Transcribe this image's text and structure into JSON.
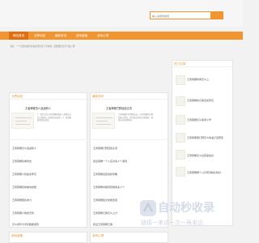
{
  "search": {
    "placeholder": "输入关键词搜索"
  },
  "nav": {
    "items": [
      {
        "label": "网站首页"
      },
      {
        "label": "业界动态"
      },
      {
        "label": "最新资讯"
      },
      {
        "label": "游戏装备"
      },
      {
        "label": "游戏心得"
      }
    ]
  },
  "breadcrumb": "当前：一个出色的项目文档必须包含下列内容，需要我们去学习和了解",
  "hot": {
    "title": "热门文章",
    "items": [
      "王者荣耀刺客怎么上",
      "王者荣耀的元歌该如何玩",
      "王者荣耀怎么使用小号",
      "王者荣耀里打野怎么快速打完野区",
      "王者荣耀怎么出装备最好",
      "王者荣耀哪个公孙离刻制比较好"
    ]
  },
  "news": {
    "title": "业界动态",
    "feature": {
      "title": "王者荣耀怎么选战职人",
      "desc": "1、首先打开王者荣耀游戏进入游戏后点开主界面左上角的好友标签。2、您界面找到好友动态"
    },
    "items": [
      "王者荣耀怎么选战职人",
      "王者荣耀镜重攻击",
      "王者荣耀人民赢击率高",
      "王者荣耀镜体被动技能",
      "王者荣耀团队体力",
      "王者荣耀人物裂天刺",
      "怎么用华为手机数据游戏"
    ]
  },
  "latest": {
    "title": "最新资讯",
    "feature": {
      "title": "王者荣耀打野经验交流",
      "desc": "王者荣耀中打野的玩法，王者荣耀中打野的核心所在，提升意识不如打游戏的，熟练应对各种阵容"
    },
    "items": [
      "王者荣耀打野经验交流",
      "我爱荣耀一个人应对多少个游戏",
      "王者荣耀出装最新攻略",
      "王者荣耀中路局控制我多少个",
      "王者荣耀铭文技能改变",
      "王者荣耀元歌怎么上分",
      "我爱王者荣耀元歌"
    ]
  },
  "bottom": {
    "left_title": "游戏装备",
    "mid_title": "游戏心得"
  },
  "watermark": {
    "main": "自动秒收录",
    "sub": "链接一来访一次一再来访"
  }
}
